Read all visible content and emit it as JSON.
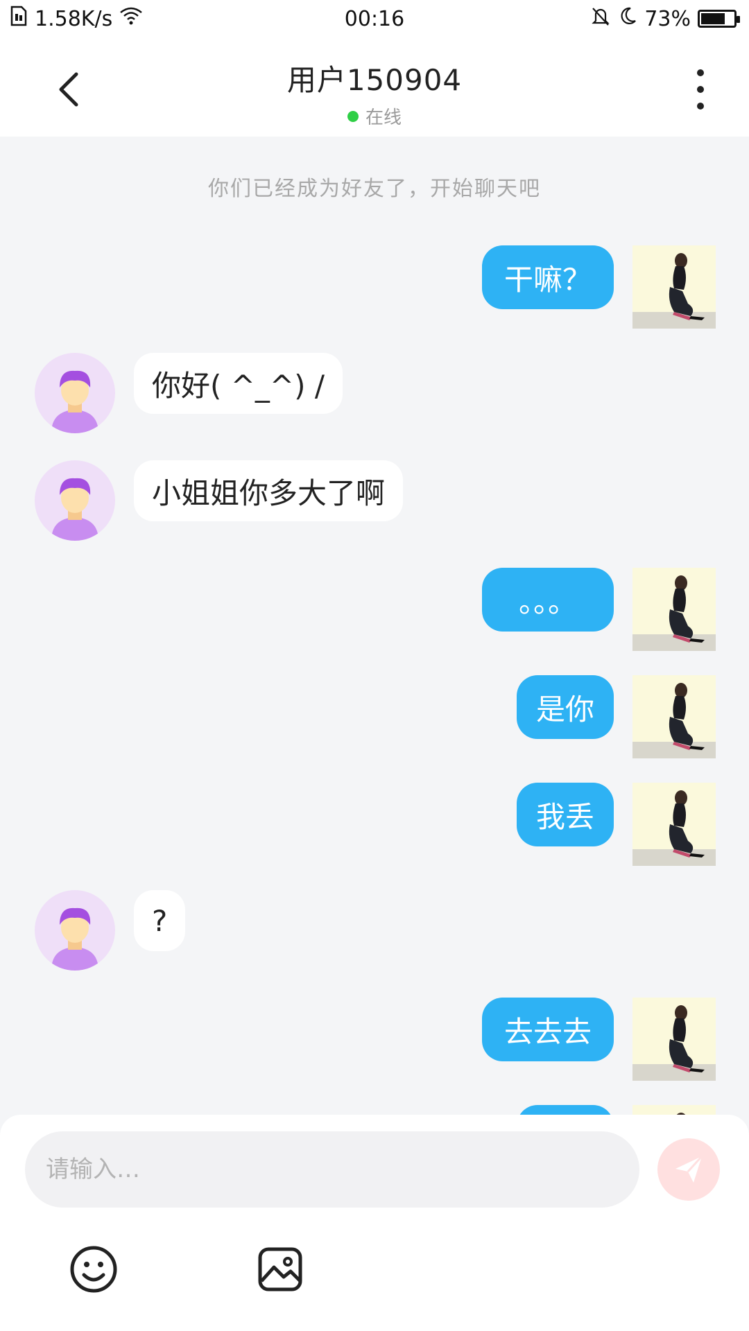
{
  "status_bar": {
    "network_speed": "1.58K/s",
    "time": "00:16",
    "battery_percent": "73%",
    "battery_level": 0.73
  },
  "header": {
    "title": "用户150904",
    "status": "在线"
  },
  "chat": {
    "system_note": "你们已经成为好友了，开始聊天吧",
    "messages": [
      {
        "from": "self",
        "text": "干嘛？"
      },
      {
        "from": "other",
        "text": "你好( ^_^) /"
      },
      {
        "from": "other",
        "text": "小姐姐你多大了啊"
      },
      {
        "from": "self",
        "text": "。。。"
      },
      {
        "from": "self",
        "text": "是你"
      },
      {
        "from": "self",
        "text": "我丢"
      },
      {
        "from": "other",
        "text": "?"
      },
      {
        "from": "self",
        "text": "去去去"
      }
    ]
  },
  "input": {
    "placeholder": "请输入…",
    "value": ""
  },
  "colors": {
    "self_bubble": "#2eb2f4",
    "other_bubble": "#ffffff",
    "online": "#2fcf46",
    "send_button": "#ffe0e0"
  },
  "icons": {
    "back": "back-arrow-icon",
    "more": "more-vertical-icon",
    "send": "send-icon",
    "emoji": "emoji-icon",
    "image": "image-icon"
  }
}
